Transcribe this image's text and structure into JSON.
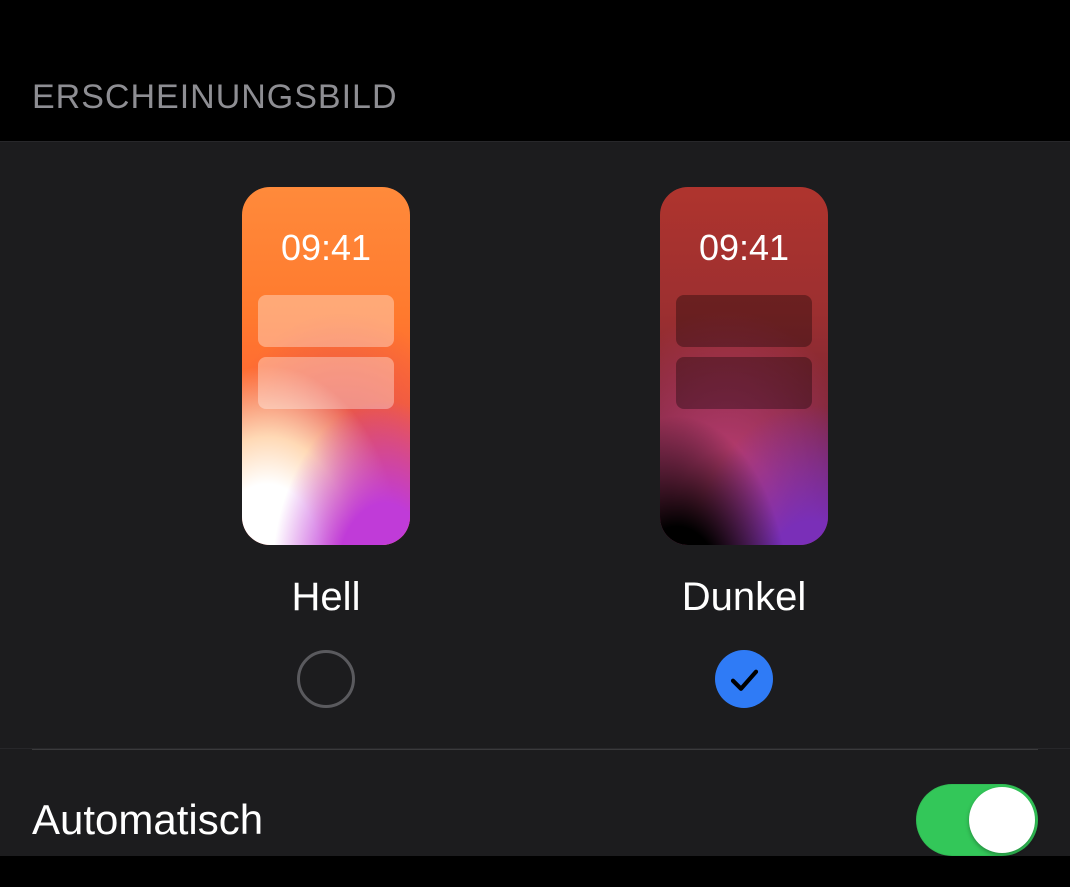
{
  "section_title": "ERSCHEINUNGSBILD",
  "preview_time": "09:41",
  "options": {
    "light": {
      "label": "Hell",
      "selected": false
    },
    "dark": {
      "label": "Dunkel",
      "selected": true
    }
  },
  "automatic": {
    "label": "Automatisch",
    "enabled": true
  },
  "colors": {
    "accent_blue": "#2f7bf6",
    "toggle_green": "#33c759",
    "panel_bg": "#1c1c1e"
  }
}
